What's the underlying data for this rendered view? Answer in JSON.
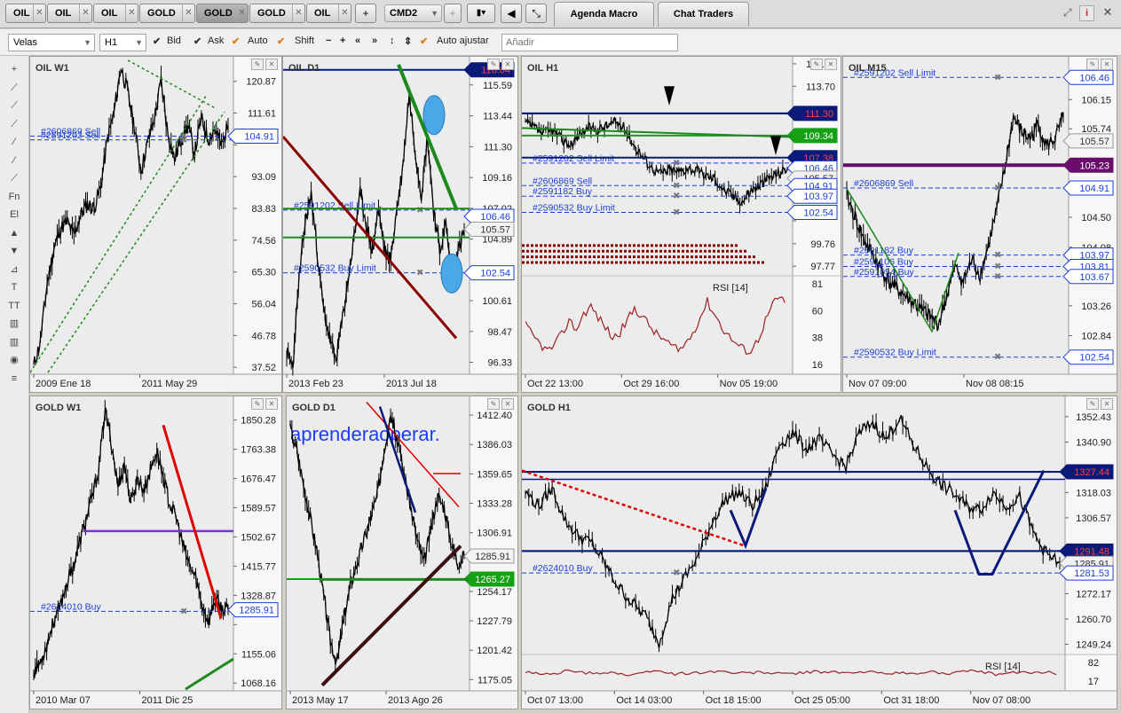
{
  "tabs": [
    {
      "label": "OIL",
      "dark": false
    },
    {
      "label": "OIL",
      "dark": false
    },
    {
      "label": "OIL",
      "dark": false
    },
    {
      "label": "GOLD",
      "dark": false
    },
    {
      "label": "GOLD",
      "dark": true
    },
    {
      "label": "GOLD",
      "dark": false
    },
    {
      "label": "OIL",
      "dark": false
    }
  ],
  "add_tab": "+",
  "layout_select": "CMD2",
  "big_tabs": [
    "Agenda Macro",
    "Chat Traders"
  ],
  "toolbar": {
    "chart_type": "Velas",
    "timeframe": "H1",
    "bid": "Bid",
    "ask": "Ask",
    "auto": "Auto",
    "shift": "Shift",
    "auto_ajustar": "Auto ajustar",
    "add_placeholder": "Añadir",
    "minus": "−",
    "plus": "+",
    "left": "«",
    "right": "»"
  },
  "left_tools": [
    "+",
    "⟋",
    "⟋",
    "⟋",
    "∕",
    "∕",
    "⟋",
    "Fn",
    "El",
    "▲",
    "▼",
    "⊿",
    "T",
    "TT",
    "▥",
    "▥",
    "◉",
    "≡"
  ],
  "watermark": "aprenderaoperar.",
  "colors": {
    "order_blue": "#1a3fd8",
    "navy": "#0a1a78",
    "green": "#1c8a1c",
    "dark_red": "#8b0000",
    "red": "#e00000",
    "purple": "#6a0d6a",
    "cyan": "#4aa8e8",
    "rsi": "#a02020"
  },
  "charts": [
    {
      "id": "oil-w1",
      "title": "OIL W1",
      "seed": 11,
      "chart_data": {
        "type": "line",
        "title": "OIL W1",
        "x": [
          "2009 Ene 18",
          "2011 May 29"
        ],
        "ylim": [
          35.5,
          127
        ],
        "yticks": [
          120.87,
          111.61,
          102.35,
          93.09,
          83.83,
          74.56,
          65.3,
          56.04,
          46.78,
          37.52
        ],
        "ytick_labels": [
          "120.87",
          "111.61",
          "",
          "93.09",
          "83.83",
          "74.56",
          "65.30",
          "56.04",
          "46.78",
          "37.52"
        ],
        "series": [
          {
            "values": [
              38,
              45,
              62,
              72,
              78,
              80,
              76,
              82,
              85,
              84,
              90,
              104,
              112,
              125,
              118,
              108,
              95,
              103,
              110,
              121,
              106,
              98,
              104,
              108,
              100,
              110,
              104,
              107,
              102,
              108
            ]
          }
        ],
        "price_tags": [
          {
            "label": "104.91",
            "value": 104.91,
            "style": "outline"
          }
        ],
        "orders": [
          {
            "label": "#2606869 Sell",
            "value": 104.91
          },
          {
            "label": "#2591202 Sell",
            "value": 103.8
          }
        ]
      }
    },
    {
      "id": "oil-d1",
      "title": "OIL D1",
      "seed": 23,
      "chart_data": {
        "type": "line",
        "title": "OIL D1",
        "x": [
          "2013 Feb 23",
          "2013 Jul 18"
        ],
        "ylim": [
          95.5,
          117.3
        ],
        "yticks": [
          115.59,
          113.44,
          111.3,
          109.16,
          107.02,
          104.89,
          102.74,
          100.61,
          98.47,
          96.33
        ],
        "ytick_labels": [
          "115.59",
          "113.44",
          "111.30",
          "109.16",
          "107.02",
          "104.89",
          "",
          "100.61",
          "98.47",
          "96.33"
        ],
        "series": [
          {
            "values": [
              97,
              96,
              102,
              106,
              108,
              104,
              100,
              98,
              96.5,
              99,
              102,
              105,
              108,
              106,
              104,
              107,
              104,
              103.5,
              107,
              110,
              115,
              111,
              108,
              112,
              107,
              104,
              106,
              102,
              104,
              105.5
            ]
          }
        ],
        "price_tags": [
          {
            "label": "116.64",
            "value": 116.64,
            "style": "navy-red"
          },
          {
            "label": "106.46",
            "value": 106.46,
            "style": "outline"
          },
          {
            "label": "105.57",
            "value": 105.57,
            "style": "gray"
          },
          {
            "label": "102.54",
            "value": 102.54,
            "style": "outline"
          }
        ],
        "orders": [
          {
            "label": "#2591202 Sell Limit",
            "value": 106.9
          },
          {
            "label": "#2590532 Buy Limit",
            "value": 102.54
          }
        ]
      }
    },
    {
      "id": "oil-h1",
      "title": "OIL H1",
      "seed": 37,
      "chart_data": {
        "type": "line",
        "title": "OIL H1",
        "x": [
          "Oct 22 13:00",
          "Oct 29 16:00",
          "Nov 05 19:00"
        ],
        "ylim": [
          97,
          116
        ],
        "yticks": [
          115.69,
          113.7,
          111.72,
          109.73,
          107.75,
          105.76,
          103.78,
          101.79,
          99.76,
          97.77
        ],
        "ytick_labels": [
          "115.69",
          "113.70",
          "",
          "",
          "",
          "",
          "",
          "",
          "99.76",
          "97.77"
        ],
        "series": [
          {
            "values": [
              110.5,
              110,
              109.5,
              109.8,
              109,
              108.5,
              109.5,
              110,
              109.8,
              110.2,
              110.5,
              110,
              108.5,
              107.5,
              106.5,
              106,
              106.3,
              106.1,
              106.5,
              106.2,
              105.8,
              105.5,
              104.5,
              104,
              103.5,
              104.5,
              105,
              105.6,
              106,
              106.4
            ]
          }
        ],
        "price_tags": [
          {
            "label": "111.30",
            "value": 111.3,
            "style": "navy-red"
          },
          {
            "label": "109.34",
            "value": 109.34,
            "style": "green"
          },
          {
            "label": "107.38",
            "value": 107.38,
            "style": "navy-red"
          },
          {
            "label": "106.46",
            "value": 106.46,
            "style": "outline"
          },
          {
            "label": "105.57",
            "value": 105.57,
            "style": "gray"
          },
          {
            "label": "104.91",
            "value": 104.91,
            "style": "outline"
          },
          {
            "label": "103.97",
            "value": 103.97,
            "style": "outline"
          },
          {
            "label": "102.54",
            "value": 102.54,
            "style": "outline"
          }
        ],
        "orders": [
          {
            "label": "#2591202 Sell Limit",
            "value": 106.9
          },
          {
            "label": "#2606869 Sell",
            "value": 104.91
          },
          {
            "label": "#2591182 Buy",
            "value": 103.97
          },
          {
            "label": "#2590532 Buy Limit",
            "value": 102.54
          }
        ],
        "rsi": {
          "label": "RSI [14]",
          "ticks": [
            "81",
            "60",
            "38",
            "16"
          ],
          "values": [
            50,
            38,
            30,
            22,
            28,
            40,
            55,
            45,
            62,
            70,
            58,
            48,
            36,
            42,
            55,
            68,
            60,
            50,
            40,
            35,
            28,
            22,
            30,
            42,
            58,
            75,
            62,
            48,
            38,
            30,
            24,
            22,
            35,
            55,
            72,
            80,
            70
          ]
        }
      }
    },
    {
      "id": "oil-m15",
      "title": "OIL M15",
      "seed": 41,
      "chart_data": {
        "type": "line",
        "title": "OIL M15",
        "x": [
          "Nov 07 09:00",
          "Nov 08 08:15"
        ],
        "ylim": [
          102.3,
          106.7
        ],
        "yticks": [
          106.15,
          105.74,
          104.5,
          104.08,
          103.26,
          102.84
        ],
        "ytick_labels": [
          "106.15",
          "105.74",
          "104.50",
          "104.08",
          "103.26",
          "102.84"
        ],
        "series": [
          {
            "values": [
              104.8,
              104.5,
              104.2,
              104.0,
              103.8,
              103.6,
              103.5,
              103.4,
              103.3,
              103.2,
              103.1,
              103.0,
              103.4,
              103.8,
              103.6,
              103.9,
              103.7,
              104.1,
              104.6,
              105.2,
              105.9,
              105.7,
              105.6,
              105.8,
              105.5,
              105.6,
              105.9
            ]
          }
        ],
        "price_tags": [
          {
            "label": "106.46",
            "value": 106.46,
            "style": "outline"
          },
          {
            "label": "105.57",
            "value": 105.57,
            "style": "gray"
          },
          {
            "label": "105.23",
            "value": 105.23,
            "style": "purple"
          },
          {
            "label": "104.91",
            "value": 104.91,
            "style": "outline"
          },
          {
            "label": "103.97",
            "value": 103.97,
            "style": "outline"
          },
          {
            "label": "103.81",
            "value": 103.81,
            "style": "outline"
          },
          {
            "label": "103.67",
            "value": 103.67,
            "style": "outline"
          },
          {
            "label": "102.54",
            "value": 102.54,
            "style": "outline"
          }
        ],
        "orders": [
          {
            "label": "#2591202 Sell Limit",
            "value": 106.46
          },
          {
            "label": "#2606869 Sell",
            "value": 104.91
          },
          {
            "label": "#2591182 Buy",
            "value": 103.97
          },
          {
            "label": "#2591106 Buy",
            "value": 103.81
          },
          {
            "label": "#2591054 Buy",
            "value": 103.67
          },
          {
            "label": "#2590532 Buy Limit",
            "value": 102.54
          }
        ]
      }
    },
    {
      "id": "gold-w1",
      "title": "GOLD W1",
      "seed": 53,
      "chart_data": {
        "type": "line",
        "title": "GOLD W1",
        "x": [
          "2010 Mar 07",
          "2011 Dic 25"
        ],
        "ylim": [
          1045,
          1910
        ],
        "yticks": [
          1850.28,
          1763.38,
          1676.47,
          1589.57,
          1502.67,
          1415.77,
          1328.87,
          1241.96,
          1155.06,
          1068.16
        ],
        "ytick_labels": [
          "1850.28",
          "1763.38",
          "1676.47",
          "1589.57",
          "1502.67",
          "1415.77",
          "1328.87",
          "",
          "1155.06",
          "1068.16"
        ],
        "series": [
          {
            "values": [
              1100,
              1130,
              1180,
              1250,
              1290,
              1360,
              1410,
              1480,
              1550,
              1620,
              1700,
              1880,
              1780,
              1650,
              1720,
              1600,
              1680,
              1640,
              1700,
              1760,
              1680,
              1600,
              1560,
              1480,
              1420,
              1380,
              1300,
              1250,
              1320,
              1290,
              1286
            ]
          }
        ],
        "price_tags": [
          {
            "label": "1285.91",
            "value": 1285.91,
            "style": "outline"
          }
        ],
        "orders": [
          {
            "label": "#2624010 Buy",
            "value": 1281.5
          }
        ]
      }
    },
    {
      "id": "gold-d1",
      "title": "GOLD D1",
      "seed": 67,
      "chart_data": {
        "type": "line",
        "title": "GOLD D1",
        "x": [
          "2013 May 17",
          "2013 Ago 26"
        ],
        "ylim": [
          1165,
          1426
        ],
        "yticks": [
          1412.4,
          1386.03,
          1359.65,
          1333.28,
          1306.91,
          1280.54,
          1254.17,
          1227.79,
          1201.42,
          1175.05
        ],
        "ytick_labels": [
          "1412.40",
          "1386.03",
          "1359.65",
          "1333.28",
          "1306.91",
          "",
          "1254.17",
          "1227.79",
          "1201.42",
          "1175.05"
        ],
        "series": [
          {
            "values": [
              1400,
              1380,
              1350,
              1320,
              1290,
              1250,
              1210,
              1190,
              1230,
              1260,
              1280,
              1300,
              1320,
              1340,
              1380,
              1415,
              1390,
              1360,
              1330,
              1300,
              1280,
              1310,
              1340,
              1330,
              1300,
              1280,
              1286
            ]
          }
        ],
        "price_tags": [
          {
            "label": "1285.91",
            "value": 1285.91,
            "style": "gray"
          },
          {
            "label": "1265.27",
            "value": 1265.27,
            "style": "green"
          }
        ]
      }
    },
    {
      "id": "gold-h1",
      "title": "GOLD H1",
      "seed": 79,
      "chart_data": {
        "type": "line",
        "title": "GOLD H1",
        "x": [
          "Oct 07 13:00",
          "Oct 14 03:00",
          "Oct 18 15:00",
          "Oct 25 05:00",
          "Oct 31 18:00",
          "Nov 07 08:00"
        ],
        "ylim": [
          1245,
          1360
        ],
        "yticks": [
          1352.43,
          1340.9,
          1318.03,
          1306.57,
          1272.17,
          1260.7,
          1249.24
        ],
        "ytick_labels": [
          "1352.43",
          "1340.90",
          "1318.03",
          "1306.57",
          "1272.17",
          "1260.70",
          "1249.24"
        ],
        "series": [
          {
            "values": [
              1318,
              1312,
              1320,
              1305,
              1298,
              1295,
              1285,
              1275,
              1268,
              1262,
              1250,
              1270,
              1280,
              1290,
              1305,
              1315,
              1318,
              1312,
              1320,
              1340,
              1345,
              1338,
              1342,
              1335,
              1330,
              1345,
              1350,
              1342,
              1352,
              1340,
              1330,
              1322,
              1318,
              1312,
              1310,
              1318,
              1312,
              1316,
              1300,
              1290,
              1286
            ]
          }
        ],
        "price_tags": [
          {
            "label": "1327.44",
            "value": 1327.44,
            "style": "navy-red"
          },
          {
            "label": "1291.48",
            "value": 1291.48,
            "style": "navy-red"
          },
          {
            "label": "1285.91",
            "value": 1285.91,
            "style": "gray"
          },
          {
            "label": "1281.53",
            "value": 1281.53,
            "style": "outline"
          }
        ],
        "orders": [
          {
            "label": "#2624010 Buy",
            "value": 1281.53
          }
        ],
        "rsi": {
          "label": "RSI [14]",
          "ticks": [
            "82",
            "17"
          ],
          "values": [
            50,
            45,
            55,
            48,
            52,
            40,
            58,
            45,
            50,
            55,
            48,
            52,
            46,
            50,
            54,
            48,
            52,
            50,
            46,
            52,
            48,
            55,
            45,
            50,
            52,
            48
          ]
        }
      }
    }
  ]
}
